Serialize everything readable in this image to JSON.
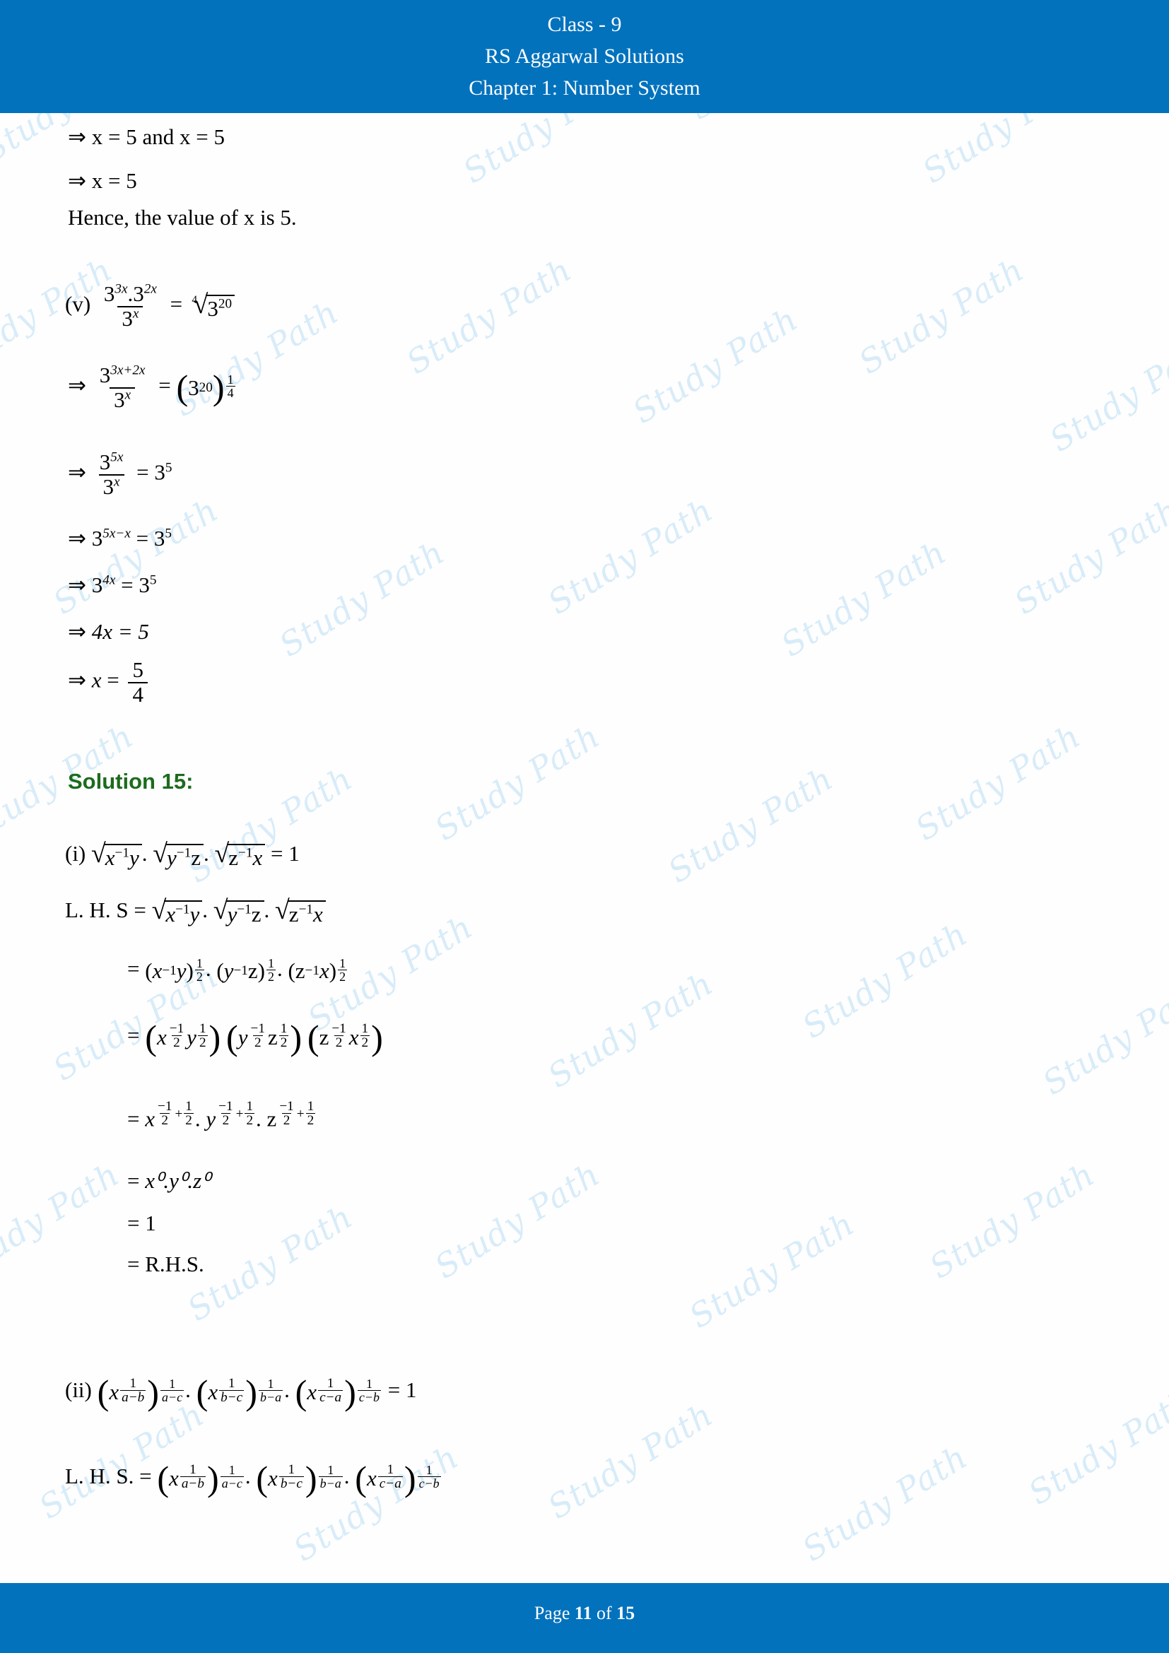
{
  "header": {
    "line1": "Class - 9",
    "line2": "RS Aggarwal Solutions",
    "line3": "Chapter 1: Number System"
  },
  "footer": {
    "prefix": "Page",
    "current_page": "11",
    "middle": "of",
    "total_pages": "15"
  },
  "watermark": {
    "text": "Study Path",
    "color": "#d6ecf8"
  },
  "colors": {
    "bar_blue": "#0272bd",
    "solution_green": "#1d6b1d",
    "page_background": "#fefeff",
    "body_text": "#000000"
  },
  "content": {
    "top_lines": [
      {
        "text": "⇒ x = 5 and x = 5"
      },
      {
        "text": "⇒ x = 5"
      },
      {
        "text": "Hence, the value of x is 5."
      }
    ],
    "part_v": {
      "label": "(v)",
      "statement": "3^{3x}.3^{2x} / 3^{x} = ⁴√(3^{20})",
      "numerator_base": "3",
      "numerator_exp_1": "3x",
      "numerator_dot": ".",
      "numerator_base_2": "3",
      "numerator_exp_2": "2x",
      "denominator_base": "3",
      "denominator_exp": "x",
      "equals": "=",
      "root_index": "4",
      "root_base": "3",
      "root_exp": "20"
    },
    "part_v_steps": [
      {
        "arrow": "⇒",
        "num_base": "3",
        "num_exp": "3x+2x",
        "den_base": "3",
        "den_exp": "x",
        "equals": "=",
        "rhs_base": "3",
        "rhs_exp": "20",
        "rhs_outer_num": "1",
        "rhs_outer_den": "4"
      },
      {
        "arrow": "⇒",
        "num_base": "3",
        "num_exp": "5x",
        "den_base": "3",
        "den_exp": "x",
        "equals": "=",
        "rhs_base": "3",
        "rhs_exp": "5"
      },
      {
        "arrow": "⇒",
        "lhs_base": "3",
        "lhs_exp": "5x−x",
        "equals": "=",
        "rhs_base": "3",
        "rhs_exp": "5"
      },
      {
        "arrow": "⇒",
        "lhs_base": "3",
        "lhs_exp": "4x",
        "equals": "=",
        "rhs_base": "3",
        "rhs_exp": "5"
      },
      {
        "arrow": "⇒",
        "text": "4x = 5"
      },
      {
        "arrow": "⇒",
        "lhs": "x",
        "equals": "=",
        "frac_num": "5",
        "frac_den": "4"
      }
    ],
    "solution_heading": "Solution 15:",
    "part_i": {
      "label": "(i)",
      "statement_rhs": "1",
      "lhs_label": "L. H. S",
      "radicands": [
        {
          "base": "x",
          "exp": "−1",
          "tail": "y"
        },
        {
          "base": "y",
          "exp": "−1",
          "tail": "z"
        },
        {
          "base": "z",
          "exp": "−1",
          "tail": "x"
        }
      ],
      "steps": [
        {
          "equals": "=",
          "groups": [
            {
              "base": "x",
              "exp": "−1",
              "tail": "y",
              "outer_num": "1",
              "outer_den": "2"
            },
            {
              "base": "y",
              "exp": "−1",
              "tail": "z",
              "outer_num": "1",
              "outer_den": "2"
            },
            {
              "base": "z",
              "exp": "−1",
              "tail": "x",
              "outer_num": "1",
              "outer_den": "2"
            }
          ]
        },
        {
          "equals": "=",
          "pairs": [
            {
              "v1": "x",
              "e1num": "−1",
              "e1den": "2",
              "v2": "y",
              "e2num": "1",
              "e2den": "2"
            },
            {
              "v1": "y",
              "e1num": "−1",
              "e1den": "2",
              "v2": "z",
              "e2num": "1",
              "e2den": "2"
            },
            {
              "v1": "z",
              "e1num": "−1",
              "e1den": "2",
              "v2": "x",
              "e2num": "1",
              "e2den": "2"
            }
          ]
        },
        {
          "equals": "=",
          "terms": [
            {
              "base": "x",
              "n1": "−1",
              "d1": "2",
              "sign": "+",
              "n2": "1",
              "d2": "2"
            },
            {
              "base": "y",
              "n1": "−1",
              "d1": "2",
              "sign": "+",
              "n2": "1",
              "d2": "2"
            },
            {
              "base": "z",
              "n1": "−1",
              "d1": "2",
              "sign": "+",
              "n2": "1",
              "d2": "2"
            }
          ]
        },
        {
          "equals": "=",
          "zero_text": "x⁰.y⁰.z⁰"
        },
        {
          "equals": "=",
          "value": "1"
        },
        {
          "equals": "=",
          "value": "R.H.S."
        }
      ]
    },
    "part_ii": {
      "label": "(ii)",
      "lhs_label": "L. H. S.",
      "equals": "=",
      "result": "1",
      "factors": [
        {
          "base": "x",
          "inner_num": "1",
          "inner_den": "a−b",
          "outer_num": "1",
          "outer_den": "a−c"
        },
        {
          "base": "x",
          "inner_num": "1",
          "inner_den": "b−c",
          "outer_num": "1",
          "outer_den": "b−a"
        },
        {
          "base": "x",
          "inner_num": "1",
          "inner_den": "c−a",
          "outer_num": "1",
          "outer_den": "c−b"
        }
      ],
      "separator": "."
    }
  }
}
